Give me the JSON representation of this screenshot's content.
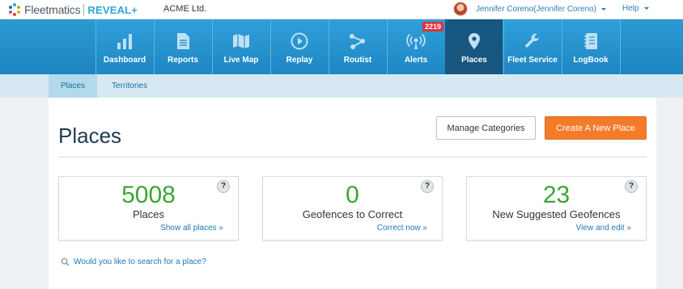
{
  "topbar": {
    "logo_text": "Fleetmatics",
    "logo_reveal": "REVEAL+",
    "company": "ACME Ltd.",
    "user_name": "Jennifer Coreno(Jennifer Coreno)",
    "help_label": "Help"
  },
  "nav": {
    "items": [
      {
        "label": "Dashboard",
        "icon": "bar-chart-icon"
      },
      {
        "label": "Reports",
        "icon": "document-icon"
      },
      {
        "label": "Live Map",
        "icon": "map-icon"
      },
      {
        "label": "Replay",
        "icon": "play-icon"
      },
      {
        "label": "Routist",
        "icon": "route-icon"
      },
      {
        "label": "Alerts",
        "icon": "broadcast-icon"
      },
      {
        "label": "Places",
        "icon": "map-pin-icon"
      },
      {
        "label": "Fleet Service",
        "icon": "wrench-icon"
      },
      {
        "label": "LogBook",
        "icon": "notebook-icon"
      }
    ],
    "active": "Places",
    "alerts_badge": "2219"
  },
  "subnav": {
    "tabs": [
      {
        "label": "Places"
      },
      {
        "label": "Territories"
      }
    ],
    "active": "Places"
  },
  "main": {
    "title": "Places",
    "manage_label": "Manage Categories",
    "create_label": "Create A New Place",
    "cards": [
      {
        "value": "5008",
        "caption": "Places",
        "link": "Show all places »",
        "help": "?"
      },
      {
        "value": "0",
        "caption": "Geofences to Correct",
        "link": "Correct now »",
        "help": "?"
      },
      {
        "value": "23",
        "caption": "New Suggested Geofences",
        "link": "View and edit »",
        "help": "?"
      }
    ],
    "search_hint": "Would you like to search for a place?"
  },
  "colors": {
    "nav_blue": "#2d9ad3",
    "nav_active": "#17577f",
    "create_orange": "#f47b2a",
    "stat_green": "#3aa635",
    "badge_red": "#d9353a",
    "link_blue": "#1d78b8"
  }
}
